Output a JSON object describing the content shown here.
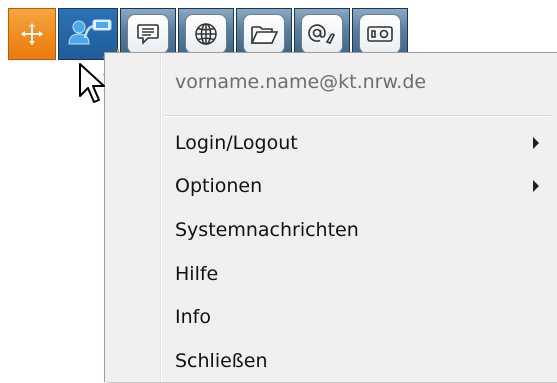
{
  "toolbar": {
    "buttons": [
      {
        "icon": "move-arrows-icon"
      },
      {
        "icon": "user-switch-icon"
      },
      {
        "icon": "chat-bubble-icon"
      },
      {
        "icon": "globe-icon"
      },
      {
        "icon": "folder-icon"
      },
      {
        "icon": "at-sign-icon"
      },
      {
        "icon": "card-reader-icon"
      }
    ],
    "colors": {
      "move": "#ef8a1d",
      "active": "#1f5c98",
      "default": "#4b6d8f"
    }
  },
  "menu": {
    "header": "vorname.name@kt.nrw.de",
    "items": [
      {
        "label": "Login/Logout",
        "submenu": true
      },
      {
        "label": "Optionen",
        "submenu": true
      },
      {
        "label": "Systemnachrichten",
        "submenu": false
      },
      {
        "label": "Hilfe",
        "submenu": false
      },
      {
        "label": "Info",
        "submenu": false
      },
      {
        "label": "Schließen",
        "submenu": false
      }
    ]
  }
}
